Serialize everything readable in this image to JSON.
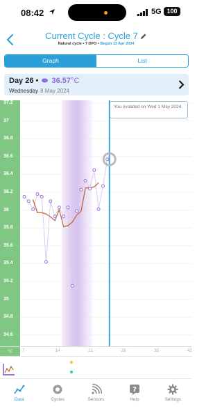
{
  "status_bar": {
    "time": "08:42",
    "network": "5G",
    "battery": "100"
  },
  "header": {
    "title": "Current Cycle : Cycle 7",
    "subtitle_prefix": "Natural cycle  •  7 DPO  •  ",
    "subtitle_began": "Began 13 Apr 2024"
  },
  "tabs": [
    {
      "label": "Graph",
      "active": true
    },
    {
      "label": "List",
      "active": false
    }
  ],
  "day_card": {
    "day": "Day 26 •",
    "temp": "36.57",
    "unit": "°C",
    "weekday": "Wednesday",
    "date": "8 May 2024"
  },
  "chart": {
    "y_labels": [
      "37.2",
      "37",
      "36.8",
      "36.6",
      "36.4",
      "36.2",
      "36",
      "35.8",
      "35.6",
      "35.4",
      "35.2",
      "35",
      "34.8",
      "34.6"
    ],
    "x_unit": "°C",
    "x_labels": [
      "7",
      "14",
      "21",
      "28",
      "35",
      "42"
    ],
    "tooltip": "You ovulated on Wed 1 May 2024."
  },
  "chart_data": {
    "type": "line",
    "ylim": [
      34.5,
      37.2
    ],
    "xlim": [
      6.5,
      43
    ],
    "series": [
      {
        "values": [
          [
            1,
            36.15
          ],
          [
            2,
            36.1
          ],
          [
            3,
            36.01
          ],
          [
            4,
            36.18
          ],
          [
            5,
            36.15
          ],
          [
            6,
            35.42
          ],
          [
            7,
            36.1
          ],
          [
            8,
            35.93
          ],
          [
            9,
            36.03
          ],
          [
            10,
            35.93
          ],
          [
            11,
            36.03
          ],
          [
            12,
            35.15
          ],
          [
            13,
            35.99
          ],
          [
            14,
            36.23
          ],
          [
            15,
            36.33
          ],
          [
            16,
            36.24
          ],
          [
            17,
            36.45
          ],
          [
            18,
            36.01
          ],
          [
            19,
            36.27
          ],
          [
            20,
            36.57
          ]
        ]
      }
    ],
    "ovulation_line_x": 20
  },
  "nav": [
    {
      "label": "Data",
      "icon": "data-icon",
      "active": true
    },
    {
      "label": "Cycles",
      "icon": "cycles-icon",
      "active": false
    },
    {
      "label": "Sensors",
      "icon": "sensors-icon",
      "active": false
    },
    {
      "label": "Help",
      "icon": "help-icon",
      "active": false
    },
    {
      "label": "Settings",
      "icon": "settings-icon",
      "active": false
    }
  ],
  "colors": {
    "accent": "#2a9fd8",
    "axis_green": "#7fc783",
    "temp_purple": "#8a68e0",
    "trend_brown": "#c0693a"
  }
}
